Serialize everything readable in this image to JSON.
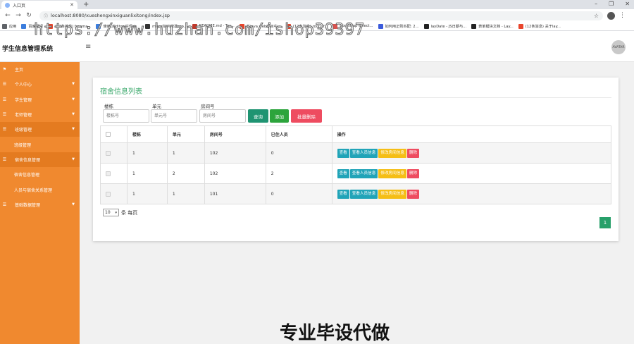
{
  "browser": {
    "tab_title": "入口页",
    "url": "localhost:8080/xueshengxinxiguanlixitong/index.jsp",
    "bookmarks": [
      {
        "label": "应用",
        "color": "#5f6368"
      },
      {
        "label": "百度翻译",
        "color": "#3b7ddd"
      },
      {
        "label": "(12条消息) freema...",
        "color": "#e8452c"
      },
      {
        "label": "使用UEditor 实现ch...",
        "color": "#3b7ddd"
      },
      {
        "label": "mysql如何修改roo...",
        "color": "#333333"
      },
      {
        "label": "README.md · Tev...",
        "color": "#c0392b"
      },
      {
        "label": "在java web项目中...",
        "color": "#e8452c"
      },
      {
        "label": "(12条消息) root of...",
        "color": "#e8452c"
      },
      {
        "label": "bootstrap-select...",
        "color": "#d9534f"
      },
      {
        "label": "如何用正则匹配: 2...",
        "color": "#3b5bdb"
      },
      {
        "label": "layDate - JS日期与...",
        "color": "#222222"
      },
      {
        "label": "表单模块文档 - Lay...",
        "color": "#222222"
      },
      {
        "label": "(12条消息) 关于lay...",
        "color": "#e8452c"
      }
    ]
  },
  "watermark": "https://www.huzhan.com/ishop39397",
  "bottom_banner": "专业毕设代做",
  "header": {
    "brand": "学生信息管理系统",
    "menu_icon": "hamburger-icon",
    "avatar_text": "AVATAR"
  },
  "sidebar": {
    "items": [
      {
        "label": "主页",
        "icon": "flag-icon",
        "sub": false,
        "caret": false,
        "active": false
      },
      {
        "label": "个人中心",
        "icon": "menu-icon",
        "sub": false,
        "caret": true,
        "active": false
      },
      {
        "label": "学生管理",
        "icon": "menu-icon",
        "sub": false,
        "caret": true,
        "active": false
      },
      {
        "label": "老师管理",
        "icon": "menu-icon",
        "sub": false,
        "caret": true,
        "active": false
      },
      {
        "label": "班级管理",
        "icon": "menu-icon",
        "sub": false,
        "caret": true,
        "active": true
      },
      {
        "label": "班级管理",
        "icon": "",
        "sub": true,
        "caret": false,
        "active": false
      },
      {
        "label": "宿舍信息管理",
        "icon": "menu-icon",
        "sub": false,
        "caret": true,
        "active": true
      },
      {
        "label": "宿舍信息管理",
        "icon": "",
        "sub": true,
        "caret": false,
        "active": false
      },
      {
        "label": "人员与宿舍关系管理",
        "icon": "",
        "sub": true,
        "caret": false,
        "active": false
      },
      {
        "label": "基础数据管理",
        "icon": "menu-icon",
        "sub": false,
        "caret": true,
        "active": false
      }
    ]
  },
  "panel": {
    "title": "宿舍信息列表",
    "filters": [
      {
        "label": "楼栋",
        "placeholder": "楼栋号"
      },
      {
        "label": "单元",
        "placeholder": "单元号"
      },
      {
        "label": "房间号",
        "placeholder": "房间号"
      }
    ],
    "buttons": {
      "search": "查询",
      "add": "添加",
      "batch_delete": "批量删除"
    },
    "table": {
      "columns": [
        "",
        "楼栋",
        "单元",
        "房间号",
        "已住人员",
        "操作"
      ],
      "rows": [
        {
          "building": "1",
          "unit": "1",
          "room": "102",
          "occupants": "0"
        },
        {
          "building": "1",
          "unit": "2",
          "room": "102",
          "occupants": "2"
        },
        {
          "building": "1",
          "unit": "1",
          "room": "101",
          "occupants": "0"
        }
      ],
      "row_actions": [
        "查看",
        "查看人员信息",
        "修改房间信息",
        "删除"
      ]
    },
    "page_size": {
      "value": "10",
      "suffix": "条 每页"
    },
    "current_page": "1"
  },
  "colors": {
    "sidebar_bg": "#f0892f",
    "title_green": "#3aa86b",
    "btn_search": "#1f9472",
    "btn_add": "#2ca43c",
    "btn_delete": "#ee4c60",
    "action_teal": "#21a4b8",
    "action_yellow": "#f5be15",
    "action_red": "#ee4c60",
    "pager": "#28a06a"
  }
}
